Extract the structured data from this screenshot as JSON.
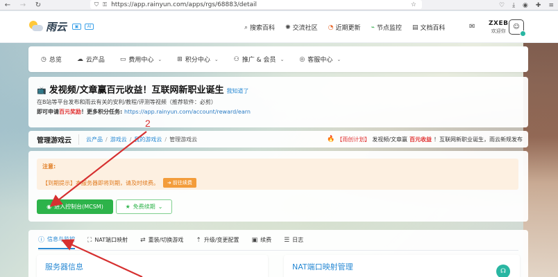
{
  "browser": {
    "url": "https://app.rainyun.com/apps/rgs/68883/detail"
  },
  "header": {
    "logo_text": "雨云",
    "badge1": "▣",
    "badge2": "AI",
    "nav": [
      {
        "label": "搜索百科",
        "icon": "search-icon"
      },
      {
        "label": "交流社区",
        "icon": "community-icon"
      },
      {
        "label": "近期更新",
        "icon": "update-icon"
      },
      {
        "label": "节点监控",
        "icon": "monitor-icon"
      },
      {
        "label": "文档百科",
        "icon": "document-icon"
      }
    ],
    "user_name": "ZXEB",
    "user_greeting": "欢迎你"
  },
  "menu": {
    "items": [
      {
        "label": "总览",
        "has_caret": false
      },
      {
        "label": "云产品",
        "has_caret": false
      },
      {
        "label": "费用中心",
        "has_caret": true
      },
      {
        "label": "积分中心",
        "has_caret": true
      },
      {
        "label": "推广 & 会员",
        "has_caret": true
      },
      {
        "label": "客服中心",
        "has_caret": true
      }
    ]
  },
  "announcement": {
    "title": "发视频/文章赢百元收益！互联网新职业诞生",
    "title_sub": "我知道了",
    "line2": "在B站等平台发布和雨云有关的安利/教程/评测等视频（推荐软件：必剪）",
    "line3_prefix": "即可申请",
    "line3_highlight": "百元奖励",
    "line3_mid": "！更多积分任务: ",
    "line3_link": "https://app.rainyun.com/account/reward/earn"
  },
  "breadcrumb": {
    "title": "管理游戏云",
    "items": [
      "云产品",
      "游戏云",
      "我的游戏云",
      "管理游戏云"
    ],
    "notice_tag": "【雨创计划】",
    "notice_text1": "发视频/文章赢",
    "notice_bold": "百元收益",
    "notice_text2": "！互联网新职业诞生，雨云新规发布"
  },
  "main_panel": {
    "notice_head": "注意:",
    "notice_body": "【到期提示】本服务器即将到期，请及时续费。",
    "renew_label": "前往续费",
    "console_label": "进入控制台(MCSM)",
    "free_renew_label": "免费续期"
  },
  "tabs": {
    "items": [
      {
        "label": "信息与监控",
        "active": true
      },
      {
        "label": "NAT端口映射",
        "active": false
      },
      {
        "label": "重装/切换游戏",
        "active": false
      },
      {
        "label": "升级/变更配置",
        "active": false
      },
      {
        "label": "续费",
        "active": false
      },
      {
        "label": "日志",
        "active": false
      }
    ]
  },
  "cards": {
    "server_title": "服务器信息",
    "nat_title": "NAT端口映射管理"
  },
  "annotation": {
    "step_number": "2",
    "color": "#d63030"
  },
  "colors": {
    "accent_blue": "#2a8ad4",
    "success_green": "#2db34a",
    "warning_orange": "#e07a1e",
    "alert_red": "#e03030"
  }
}
